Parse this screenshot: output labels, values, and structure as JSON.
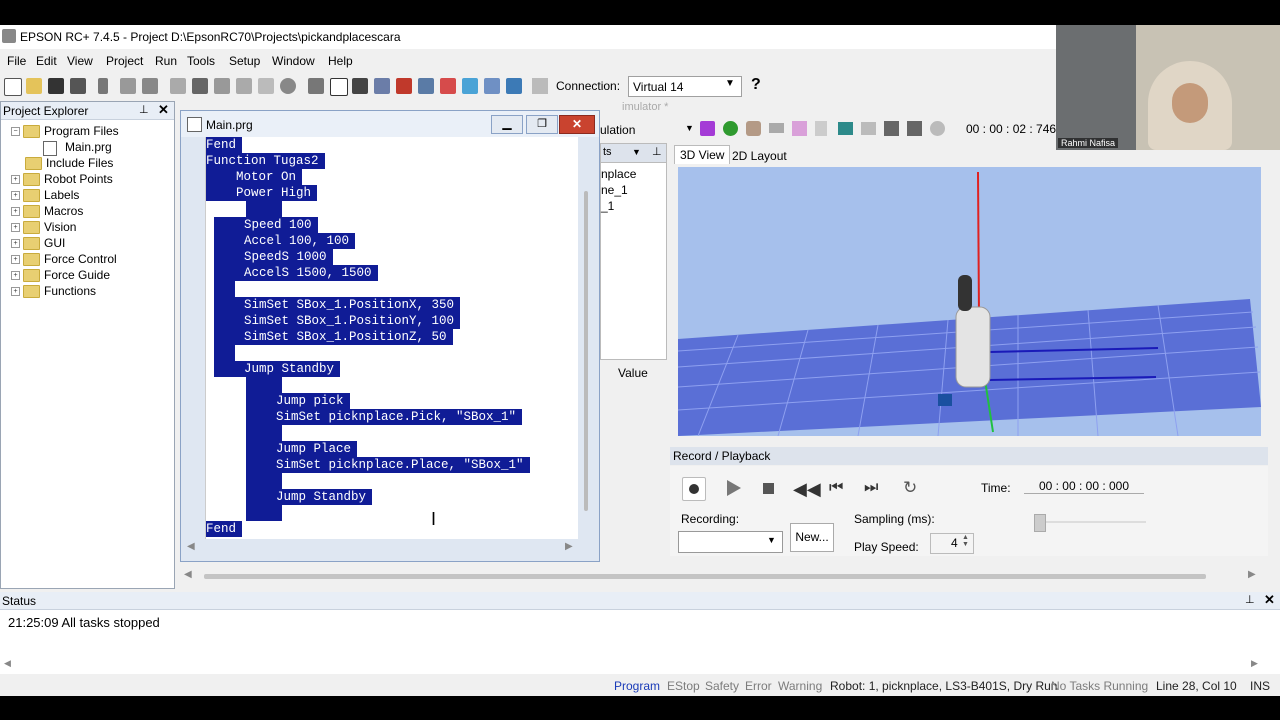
{
  "window": {
    "title": "EPSON RC+ 7.4.5 - Project D:\\EpsonRC70\\Projects\\pickandplacescara"
  },
  "menu": [
    "File",
    "Edit",
    "View",
    "Project",
    "Run",
    "Tools",
    "Setup",
    "Window",
    "Help"
  ],
  "toolbar": {
    "connection_label": "Connection:",
    "connection_value": "Virtual 14",
    "help_label": "?"
  },
  "explorer": {
    "title": "Project Explorer",
    "items": [
      {
        "label": "Program Files",
        "expand": "−"
      },
      {
        "label": "Main.prg",
        "expand": ""
      },
      {
        "label": "Include Files",
        "expand": ""
      },
      {
        "label": "Robot Points",
        "expand": "+"
      },
      {
        "label": "Labels",
        "expand": "+"
      },
      {
        "label": "Macros",
        "expand": "+"
      },
      {
        "label": "Vision",
        "expand": "+"
      },
      {
        "label": "GUI",
        "expand": "+"
      },
      {
        "label": "Force Control",
        "expand": "+"
      },
      {
        "label": "Force Guide",
        "expand": "+"
      },
      {
        "label": "Functions",
        "expand": "+"
      }
    ]
  },
  "editor": {
    "title": "Main.prg",
    "lines": [
      "Fend",
      "Function Tugas2",
      "    Motor On",
      "    Power High",
      "    ",
      "    Speed 100",
      "    Accel 100, 100",
      "    SpeedS 1000",
      "    AccelS 1500, 1500",
      "  ",
      "    SimSet SBox_1.PositionX, 350",
      "    SimSet SBox_1.PositionY, 100",
      "    SimSet SBox_1.PositionZ, 50",
      "  ",
      "    Jump Standby",
      "    ",
      "    Jump pick",
      "    SimSet picknplace.Pick, \"SBox_1\"",
      "    ",
      "    Jump Place",
      "    SimSet picknplace.Place, \"SBox_1\"",
      "    ",
      "    Jump Standby",
      "    ",
      "Fend"
    ]
  },
  "simulator": {
    "title_partial": "imulator *",
    "mode": "ulation",
    "timer": "00 : 00 : 02 : 746",
    "objects": [
      "nplace",
      "ne_1",
      "_1"
    ],
    "value_header": "Value",
    "tabs": [
      "3D View",
      "2D Layout"
    ],
    "record": {
      "title": "Record / Playback",
      "time_label": "Time:",
      "time_value": "00 : 00 : 00 : 000",
      "recording_label": "Recording:",
      "new_button": "New...",
      "sampling_label": "Sampling (ms):",
      "play_speed_label": "Play Speed:",
      "play_speed_value": "4"
    }
  },
  "webcam": {
    "name": "Rahmi Nafisa"
  },
  "status_panel": {
    "title": "Status",
    "message": "21:25:09 All tasks stopped"
  },
  "statusbar": {
    "program": "Program",
    "estop": "EStop",
    "safety": "Safety",
    "error": "Error",
    "warning": "Warning",
    "robot": "Robot: 1, picknplace, LS3-B401S, Dry Run",
    "tasks": "No Tasks Running",
    "position": "Line 28, Col 10",
    "mode": "INS"
  },
  "colors": {
    "selection": "#101c96",
    "sky": "#a6c0ec",
    "floor": "#5a6fd6"
  }
}
